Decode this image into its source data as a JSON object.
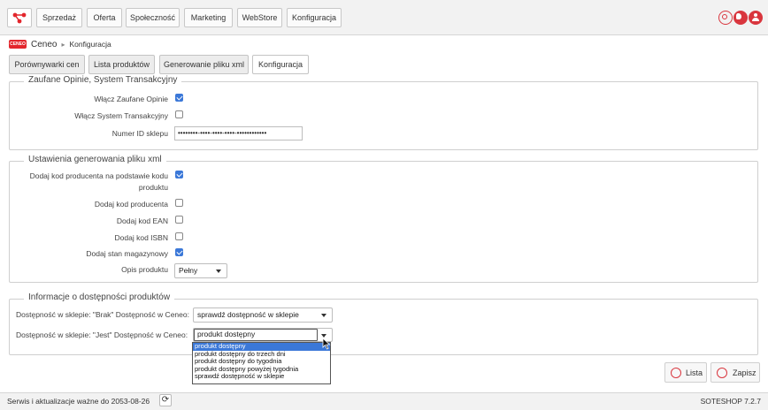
{
  "topnav": {
    "items": [
      "Sprzedaż",
      "Oferta",
      "Społeczność",
      "Marketing",
      "WebStore",
      "Konfiguracja"
    ]
  },
  "breadcrumb": {
    "app": "Ceneo",
    "separator": "▸",
    "section": "Konfiguracja",
    "logo_text": "CENEO"
  },
  "tabs": [
    "Porównywarki cen",
    "Lista produktów",
    "Generowanie pliku xml",
    "Konfiguracja"
  ],
  "section1": {
    "legend": "Zaufane Opinie, System Transakcyjny",
    "zaufane_label": "Włącz Zaufane Opinie",
    "zaufane_checked": true,
    "system_label": "Włącz System Transakcyjny",
    "system_checked": false,
    "shop_id_label": "Numer ID sklepu",
    "shop_id_value": "••••••••-••••-••••-••••-••••••••••••"
  },
  "section2": {
    "legend": "Ustawienia generowania pliku xml",
    "kod_producenta_podstawie_label_1": "Dodaj kod producenta na podstawie kodu",
    "kod_producenta_podstawie_label_2": "produktu",
    "kod_producenta_podstawie_checked": true,
    "kod_producenta_label": "Dodaj kod producenta",
    "kod_producenta_checked": false,
    "ean_label": "Dodaj kod EAN",
    "ean_checked": false,
    "isbn_label": "Dodaj kod ISBN",
    "isbn_checked": false,
    "stan_label": "Dodaj stan magazynowy",
    "stan_checked": true,
    "opis_label": "Opis produktu",
    "opis_value": "Pełny"
  },
  "section3": {
    "legend": "Informacje o dostępności produktów",
    "brak_label": "Dostępność w sklepie: \"Brak\" Dostępność w Ceneo:",
    "brak_value": "sprawdź dostępność w sklepie",
    "jest_label": "Dostępność w sklepie: \"Jest\" Dostępność w Ceneo:",
    "jest_value": "produkt dostępny",
    "options": [
      "produkt dostępny",
      "produkt dostępny do trzech dni",
      "produkt dostępny do tygodnia",
      "produkt dostępny powyżej tygodnia",
      "sprawdź dostępność w sklepie"
    ]
  },
  "buttons": {
    "list": "Lista",
    "save": "Zapisz"
  },
  "footer": {
    "support": "Serwis i aktualizacje ważne do 2053-08-26",
    "version": "SOTESHOP 7.2.7"
  },
  "colors": {
    "accent": "#d9363e",
    "selection": "#3b78d8"
  }
}
